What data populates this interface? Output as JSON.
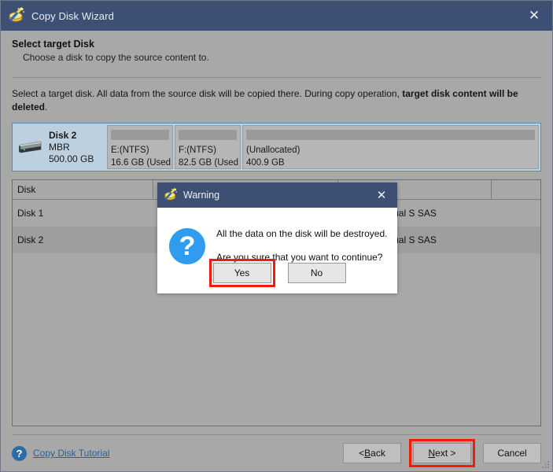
{
  "window": {
    "title": "Copy Disk Wizard",
    "app_icon": "magic-wand-disk-icon",
    "close_label": "✕"
  },
  "header": {
    "heading": "Select target Disk",
    "subheading": "Choose a disk to copy the source content to."
  },
  "main": {
    "intro_part1": "Select a target disk. All data from the source disk will be copied there. During copy operation, ",
    "intro_bold": "target disk content will be deleted",
    "intro_part2": ".",
    "disk_card": {
      "name": "Disk 2",
      "scheme": "MBR",
      "size": "500.00 GB",
      "icon": "hard-disk-icon",
      "partitions": [
        {
          "label": "E:(NTFS)",
          "detail": "16.6 GB (Used"
        },
        {
          "label": "F:(NTFS)",
          "detail": "82.5 GB (Used"
        },
        {
          "label": "(Unallocated)",
          "detail": "400.9 GB"
        }
      ]
    },
    "table": {
      "columns": [
        "Disk",
        "",
        "",
        ""
      ],
      "rows": [
        {
          "disk": "Disk 1",
          "c2": "",
          "c3": "",
          "model": "VMware Virtual S SAS"
        },
        {
          "disk": "Disk 2",
          "c2": "",
          "c3": "",
          "model": "VMware Virtual S SAS"
        }
      ]
    }
  },
  "footer": {
    "help_icon": "question-mark-icon",
    "tutorial_link": "Copy Disk Tutorial",
    "back_prefix": "< ",
    "back_mnemonic": "B",
    "back_suffix": "ack",
    "next_mnemonic": "N",
    "next_suffix": "ext >",
    "cancel_label": "Cancel"
  },
  "modal": {
    "title": "Warning",
    "app_icon": "magic-wand-disk-icon",
    "close_label": "✕",
    "icon": "question-circle-icon",
    "icon_glyph": "?",
    "line1": "All the data on the disk will be destroyed.",
    "line2": "Are you sure that you want to continue?",
    "yes_label": "Yes",
    "no_label": "No"
  },
  "background_window": {
    "ghost_text": "██████ ███   █ ███ ██ ██ ██ █  ██ ███ ██ ████ █ ████ ███"
  },
  "colors": {
    "titlebar": "#3d5074",
    "window_bg": "#a8a8a8",
    "highlight_red": "#f41b0a",
    "selected_disk_bg": "#bdd0e0",
    "selected_disk_border": "#5b86b5",
    "link_blue": "#2b5f9e",
    "question_blue": "#2f9cf0"
  }
}
